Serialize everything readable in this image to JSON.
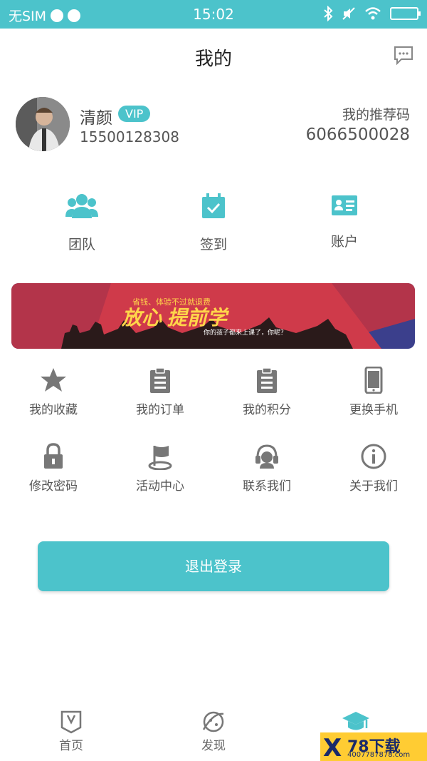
{
  "status_bar": {
    "carrier": "无SIM",
    "time": "15:02"
  },
  "header": {
    "title": "我的",
    "message_icon": "chat-icon"
  },
  "profile": {
    "name": "清颜",
    "badge": "VIP",
    "phone": "15500128308",
    "referral_label": "我的推荐码",
    "referral_code": "6066500028"
  },
  "quick_actions": [
    {
      "label": "团队",
      "icon": "team-icon"
    },
    {
      "label": "签到",
      "icon": "calendar-check-icon"
    },
    {
      "label": "账户",
      "icon": "id-card-icon"
    }
  ],
  "banner": {
    "tagline": "省钱、体验不过就退费",
    "headline": "放心 提前学",
    "subline": "你的孩子都来上课了，你呢？"
  },
  "menu_row1": [
    {
      "label": "我的收藏",
      "icon": "star-icon"
    },
    {
      "label": "我的订单",
      "icon": "clipboard-icon"
    },
    {
      "label": "我的积分",
      "icon": "clipboard-icon"
    },
    {
      "label": "更换手机",
      "icon": "phone-icon"
    }
  ],
  "menu_row2": [
    {
      "label": "修改密码",
      "icon": "lock-icon"
    },
    {
      "label": "活动中心",
      "icon": "flag-icon"
    },
    {
      "label": "联系我们",
      "icon": "headset-icon"
    },
    {
      "label": "关于我们",
      "icon": "info-icon"
    }
  ],
  "logout_label": "退出登录",
  "tabbar": [
    {
      "label": "首页",
      "icon": "book-icon"
    },
    {
      "label": "发现",
      "icon": "planet-icon"
    },
    {
      "label": "",
      "icon": "graduation-cap-icon"
    }
  ],
  "watermark": {
    "brand": "78下载",
    "url": "4007787878.com"
  },
  "colors": {
    "accent": "#4cc3cb",
    "icon_gray": "#777777"
  }
}
